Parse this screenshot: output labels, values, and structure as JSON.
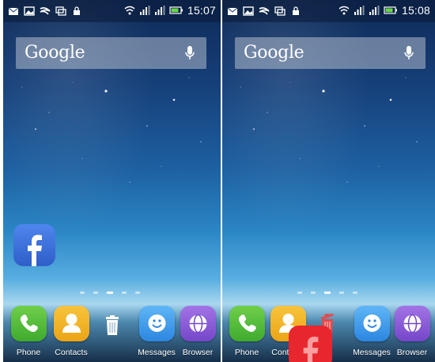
{
  "screens": [
    {
      "status": {
        "time": "15:07"
      },
      "search": {
        "logo": "Google",
        "icon": "mic-icon"
      },
      "dock": [
        {
          "label": "Phone",
          "icon": "phone-icon"
        },
        {
          "label": "Contacts",
          "icon": "contacts-icon"
        },
        {
          "label": "Messages",
          "icon": "messages-icon"
        },
        {
          "label": "Browser",
          "icon": "browser-icon"
        }
      ],
      "drag_target": {
        "icon": "trash-icon",
        "state": "idle"
      },
      "floating_app": {
        "icon": "facebook-icon",
        "color": "#3b6fd8"
      }
    },
    {
      "status": {
        "time": "15:08"
      },
      "search": {
        "logo": "Google",
        "icon": "mic-icon"
      },
      "dock": [
        {
          "label": "Phone",
          "icon": "phone-icon"
        },
        {
          "label": "Contacts",
          "icon": "contacts-icon"
        },
        {
          "label": "Messages",
          "icon": "messages-icon"
        },
        {
          "label": "Browser",
          "icon": "browser-icon"
        }
      ],
      "drag_target": {
        "icon": "trash-icon",
        "state": "active"
      },
      "floating_app": {
        "icon": "facebook-icon",
        "color": "#e8262e"
      }
    }
  ]
}
